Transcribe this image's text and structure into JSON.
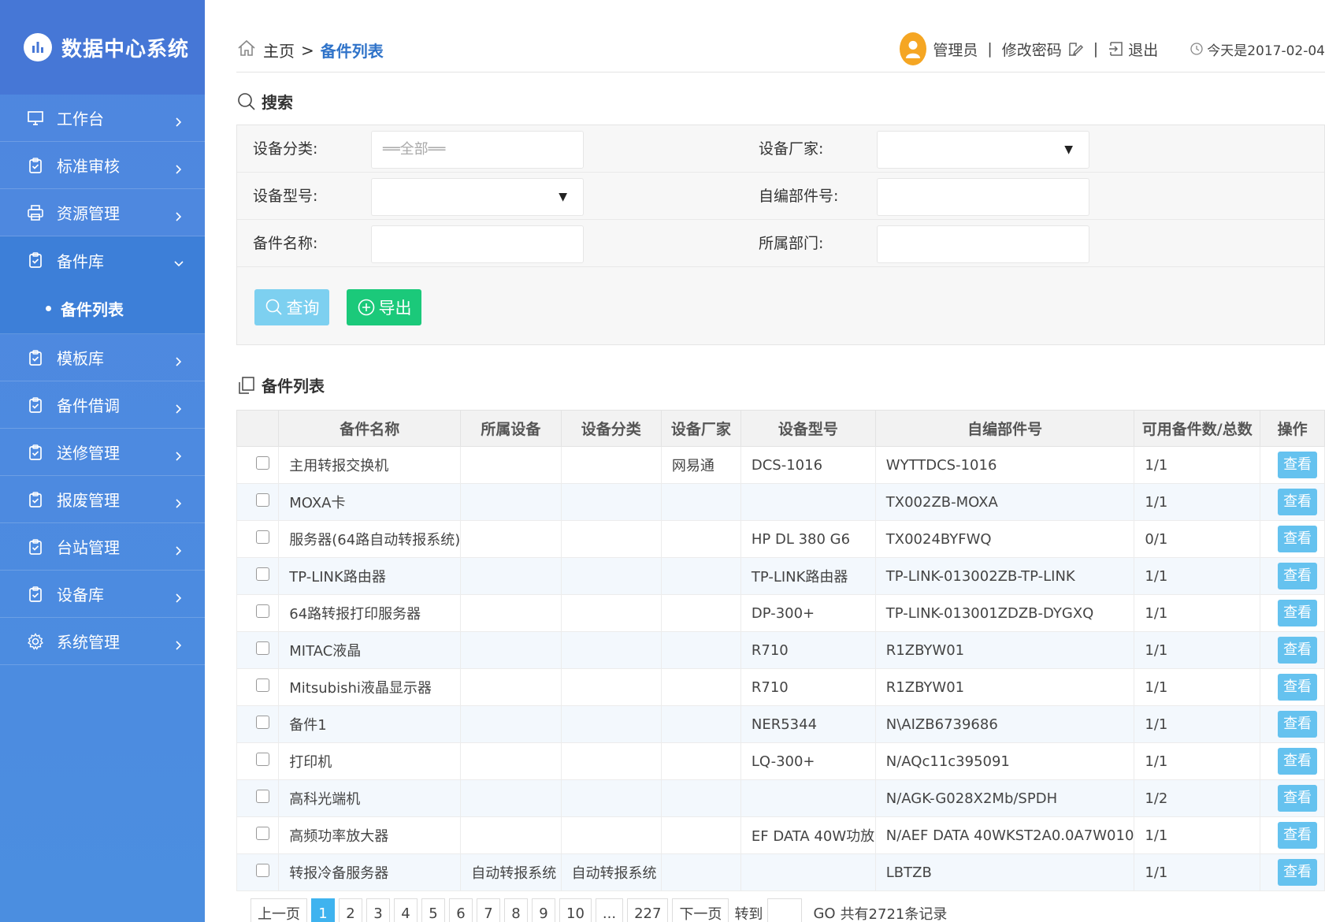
{
  "brand": {
    "title": "数据中心系统"
  },
  "sidebar": {
    "items": [
      {
        "label": "工作台",
        "icon": "monitor-icon"
      },
      {
        "label": "标准审核",
        "icon": "clipboard-icon"
      },
      {
        "label": "资源管理",
        "icon": "printer-icon"
      },
      {
        "label": "备件库",
        "icon": "clipboard-icon",
        "open": true,
        "children": [
          "备件列表"
        ]
      },
      {
        "label": "模板库",
        "icon": "clipboard-icon"
      },
      {
        "label": "备件借调",
        "icon": "clipboard-icon"
      },
      {
        "label": "送修管理",
        "icon": "clipboard-icon"
      },
      {
        "label": "报废管理",
        "icon": "clipboard-icon"
      },
      {
        "label": "台站管理",
        "icon": "clipboard-icon"
      },
      {
        "label": "设备库",
        "icon": "clipboard-icon"
      },
      {
        "label": "系统管理",
        "icon": "gear-icon"
      }
    ]
  },
  "header": {
    "breadcrumb_home": "主页",
    "breadcrumb_sep": ">",
    "breadcrumb_current": "备件列表",
    "user": "管理员",
    "change_password": "修改密码",
    "logout": "退出",
    "today": "今天是2017-02-04",
    "divider": "|"
  },
  "search": {
    "title": "搜索",
    "category_label": "设备分类:",
    "category_value": "══全部══",
    "vendor_label": "设备厂家:",
    "model_label": "设备型号:",
    "partno_label": "自编部件号:",
    "name_label": "备件名称:",
    "dept_label": "所属部门:",
    "query_button": "查询",
    "export_button": "导出",
    "caret": "▼"
  },
  "list": {
    "title": "备件列表",
    "columns": [
      "备件名称",
      "所属设备",
      "设备分类",
      "设备厂家",
      "设备型号",
      "自编部件号",
      "可用备件数/总数",
      "操作"
    ],
    "view_label": "查看",
    "rows": [
      [
        "主用转报交换机",
        "",
        "",
        "网易通",
        "DCS-1016",
        "WYTTDCS-1016",
        "1/1"
      ],
      [
        "MOXA卡",
        "",
        "",
        "",
        "",
        "TX002ZB-MOXA",
        "1/1"
      ],
      [
        "服务器(64路自动转报系统)",
        "",
        "",
        "",
        "HP DL 380 G6",
        "TX0024BYFWQ",
        "0/1"
      ],
      [
        "TP-LINK路由器",
        "",
        "",
        "",
        "TP-LINK路由器",
        "TP-LINK-013002ZB-TP-LINK",
        "1/1"
      ],
      [
        "64路转报打印服务器",
        "",
        "",
        "",
        "DP-300+",
        "TP-LINK-013001ZDZB-DYGXQ",
        "1/1"
      ],
      [
        "MITAC液晶",
        "",
        "",
        "",
        "R710",
        "R1ZBYW01",
        "1/1"
      ],
      [
        "Mitsubishi液晶显示器",
        "",
        "",
        "",
        "R710",
        "R1ZBYW01",
        "1/1"
      ],
      [
        "备件1",
        "",
        "",
        "",
        "NER5344",
        "N\\AIZB6739686",
        "1/1"
      ],
      [
        "打印机",
        "",
        "",
        "",
        "LQ-300+",
        "N/AQc11c395091",
        "1/1"
      ],
      [
        "高科光端机",
        "",
        "",
        "",
        "",
        "N/AGK-G028X2Mb/SPDH",
        "1/2"
      ],
      [
        "高频功率放大器",
        "",
        "",
        "",
        "EF DATA 40W功放",
        "N/AEF DATA 40WKST2A0.0A7W010",
        "1/1"
      ],
      [
        "转报冷备服务器",
        "自动转报系统",
        "自动转报系统",
        "",
        "",
        "LBTZB",
        "1/1"
      ]
    ]
  },
  "pager": {
    "prev": "上一页",
    "pages": [
      "1",
      "2",
      "3",
      "4",
      "5",
      "6",
      "7",
      "8",
      "9",
      "10",
      "...",
      "227"
    ],
    "active": "1",
    "next": "下一页",
    "goto": "转到",
    "go": "GO",
    "total": "共有2721条记录"
  },
  "colors": {
    "sidebar": "#4b8ee0",
    "brand": "#4677d6",
    "accent": "#2f73c9",
    "query": "#7dd0f0",
    "export": "#1bc97a",
    "view": "#65c2ef"
  }
}
